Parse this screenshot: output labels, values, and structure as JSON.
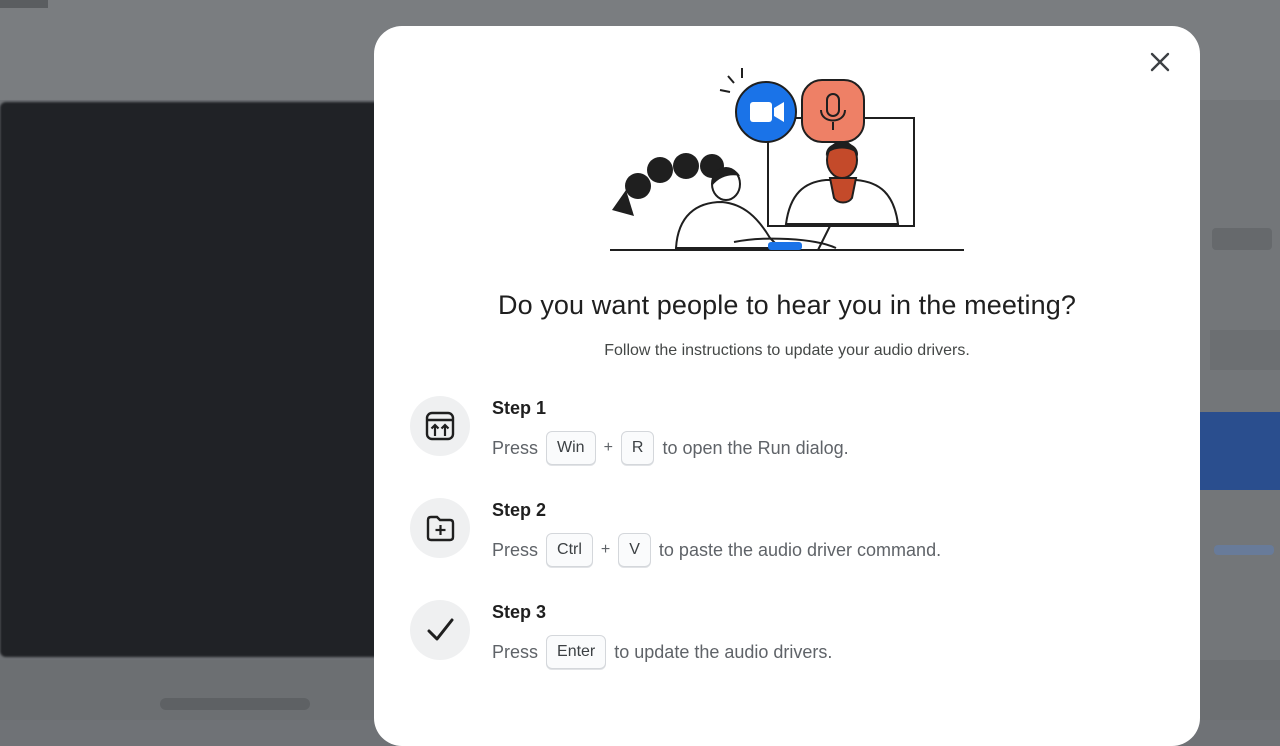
{
  "dialog": {
    "title": "Do you want people to hear you in the meeting?",
    "subtitle": "Follow the instructions to update your audio drivers.",
    "close_icon": "close-icon"
  },
  "steps": [
    {
      "icon": "run-dialog-icon",
      "title": "Step 1",
      "press": "Press",
      "keys": [
        "Win",
        "R"
      ],
      "plus": "+",
      "rest": "to open the Run dialog."
    },
    {
      "icon": "folder-add-icon",
      "title": "Step 2",
      "press": "Press",
      "keys": [
        "Ctrl",
        "V"
      ],
      "plus": "+",
      "rest": "to paste the audio driver command."
    },
    {
      "icon": "checkmark-icon",
      "title": "Step 3",
      "press": "Press",
      "keys": [
        "Enter"
      ],
      "rest": "to update the audio drivers."
    }
  ],
  "colors": {
    "camera_badge": "#1a73e8",
    "mic_badge": "#ee8066",
    "text_primary": "#1f1f1f",
    "text_secondary": "#5f6368"
  }
}
